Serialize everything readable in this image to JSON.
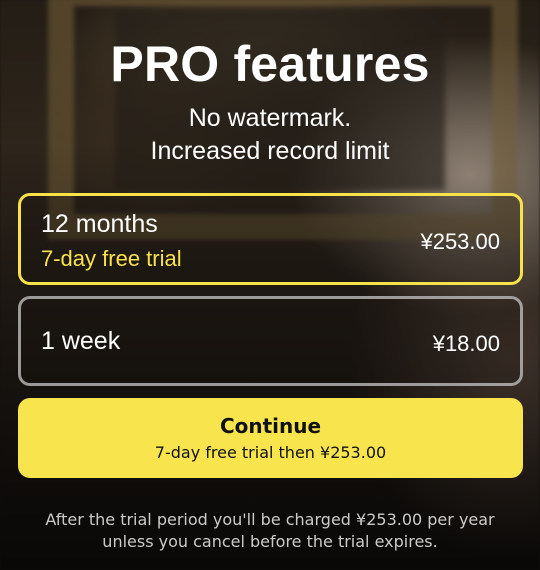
{
  "header": {
    "title": "PRO features",
    "subtitle_lines": [
      "No watermark.",
      "Increased record limit"
    ]
  },
  "plans": [
    {
      "name": "12 months",
      "trial": "7-day free trial",
      "price": "¥253.00",
      "selected": true
    },
    {
      "name": "1 week",
      "price": "¥18.00",
      "selected": false
    }
  ],
  "continue_button": {
    "label": "Continue",
    "sublabel": "7-day free trial then ¥253.00"
  },
  "disclaimer": {
    "lines": [
      "After the trial period you'll be charged ¥253.00 per year",
      "unless you cancel before the trial expires."
    ]
  },
  "colors": {
    "accent": "#f8e24a",
    "button_bg": "#f8e54e",
    "text": "#ffffff"
  }
}
